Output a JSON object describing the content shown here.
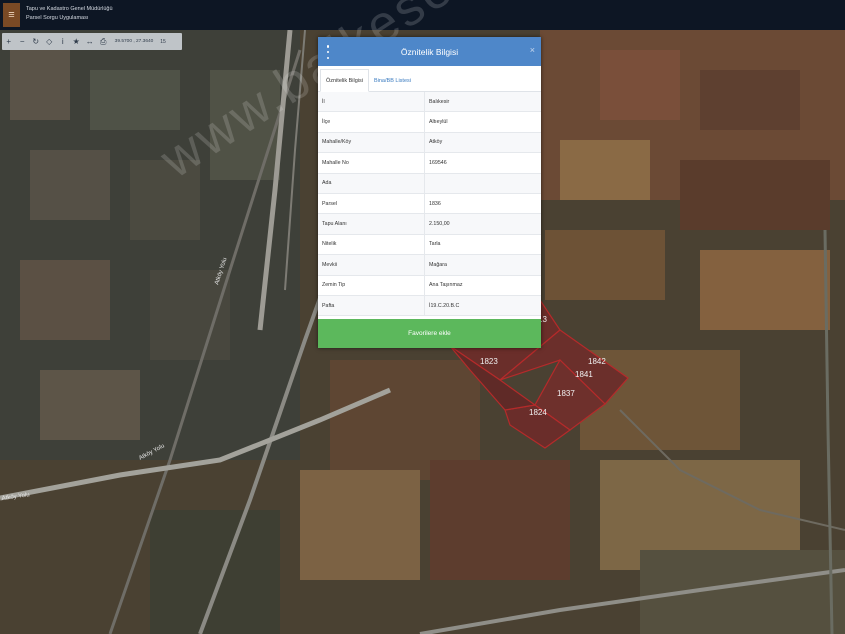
{
  "app": {
    "org_line1": "Tapu ve Kadastro Genel Müdürlüğü",
    "org_line2": "Parsel Sorgu Uygulaması"
  },
  "toolbar": {
    "coordinates": "39.5700 , 27.3640",
    "scale": "15"
  },
  "panel": {
    "title": "Öznitelik Bilgisi",
    "tabs": [
      {
        "label": "Öznitelik Bilgisi",
        "active": true
      },
      {
        "label": "Bina/BB Listesi",
        "active": false
      }
    ],
    "rows": [
      {
        "key": "İl",
        "value": "Balıkesir"
      },
      {
        "key": "İlçe",
        "value": "Altıeylül"
      },
      {
        "key": "Mahalle/Köy",
        "value": "Atköy"
      },
      {
        "key": "Mahalle No",
        "value": "169546"
      },
      {
        "key": "Ada",
        "value": ""
      },
      {
        "key": "Parsel",
        "value": "1836"
      },
      {
        "key": "Tapu Alanı",
        "value": "2.150,00"
      },
      {
        "key": "Nitelik",
        "value": "Tarla"
      },
      {
        "key": "Mevkii",
        "value": "Mağara"
      },
      {
        "key": "Zemin Tip",
        "value": "Ana Taşınmaz"
      },
      {
        "key": "Pafta",
        "value": "İ19.C.20.B.C"
      }
    ],
    "favorite_button": "Favorilere ekle"
  },
  "map": {
    "parcel_labels": [
      "1823",
      "1842",
      "1841",
      "1837",
      "1824",
      "13"
    ],
    "road_labels": [
      "Atköy Yolu",
      "Atköy Yolu",
      "Atköy Yolu"
    ],
    "watermark": "www.balkesemlak.com"
  }
}
